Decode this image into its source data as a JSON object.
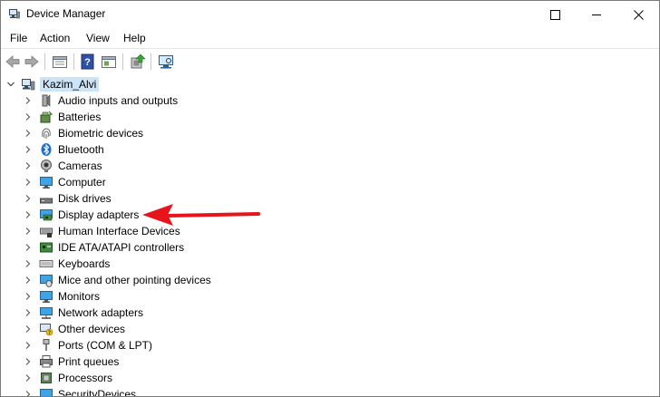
{
  "window": {
    "title": "Device Manager",
    "controls": [
      "minimize",
      "maximize",
      "close"
    ]
  },
  "menu": [
    "File",
    "Action",
    "View",
    "Help"
  ],
  "toolbar": {
    "buttons": [
      "back-icon",
      "forward-icon",
      "properties-icon",
      "help-icon",
      "show-hidden-icon",
      "update-driver-icon",
      "scan-hardware-icon"
    ]
  },
  "tree": {
    "root": {
      "label": "Kazim_Alvi",
      "icon": "computer-icon"
    },
    "items": [
      {
        "label": "Audio inputs and outputs",
        "icon": "speaker-icon"
      },
      {
        "label": "Batteries",
        "icon": "battery-icon"
      },
      {
        "label": "Biometric devices",
        "icon": "fingerprint-icon"
      },
      {
        "label": "Bluetooth",
        "icon": "bluetooth-icon"
      },
      {
        "label": "Cameras",
        "icon": "camera-icon"
      },
      {
        "label": "Computer",
        "icon": "monitor-icon"
      },
      {
        "label": "Disk drives",
        "icon": "disk-icon"
      },
      {
        "label": "Display adapters",
        "icon": "display-adapter-icon"
      },
      {
        "label": "Human Interface Devices",
        "icon": "hid-icon"
      },
      {
        "label": "IDE ATA/ATAPI controllers",
        "icon": "ide-icon"
      },
      {
        "label": "Keyboards",
        "icon": "keyboard-icon"
      },
      {
        "label": "Mice and other pointing devices",
        "icon": "mouse-icon"
      },
      {
        "label": "Monitors",
        "icon": "monitor-icon"
      },
      {
        "label": "Network adapters",
        "icon": "network-icon"
      },
      {
        "label": "Other devices",
        "icon": "other-devices-icon"
      },
      {
        "label": "Ports (COM & LPT)",
        "icon": "port-icon"
      },
      {
        "label": "Print queues",
        "icon": "printer-icon"
      },
      {
        "label": "Processors",
        "icon": "processor-icon"
      },
      {
        "label": "SecurityDevices",
        "icon": "security-icon"
      }
    ]
  },
  "colors": {
    "selection": "#cce4f7",
    "annotation_arrow": "#e8141b"
  }
}
